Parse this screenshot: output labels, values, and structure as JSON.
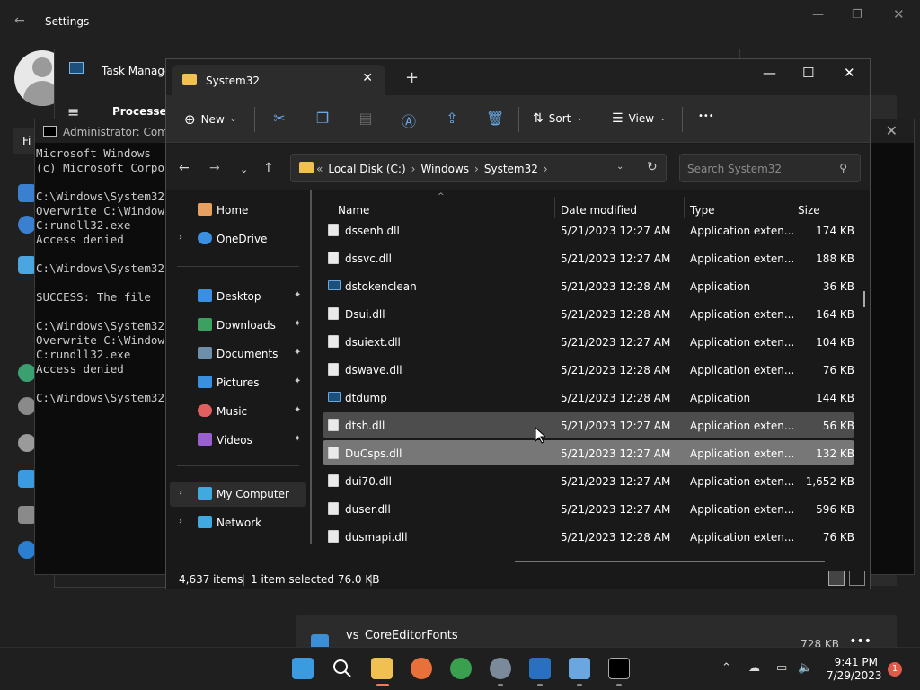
{
  "settings": {
    "title": "Settings",
    "vs_item": {
      "name": "vs_CoreEditorFonts",
      "size": "728 KB"
    }
  },
  "task_manager": {
    "title": "Task Manager",
    "section": "Processes"
  },
  "cmd": {
    "title": "Administrator: Comm",
    "lines": [
      "Microsoft Windows",
      "(c) Microsoft Corpo",
      "",
      "C:\\Windows\\System32",
      "Overwrite C:\\Window",
      "C:rundll32.exe",
      "Access denied",
      "",
      "C:\\Windows\\System32",
      "",
      "SUCCESS: The file",
      "",
      "C:\\Windows\\System32",
      "Overwrite C:\\Window",
      "C:rundll32.exe",
      "Access denied",
      "",
      "C:\\Windows\\System32"
    ],
    "fi_label": "Fi"
  },
  "explorer": {
    "tab_title": "System32",
    "toolbar": {
      "new": "New",
      "sort": "Sort",
      "view": "View",
      "more": "•••"
    },
    "address": {
      "crumbs": [
        "Local Disk (C:)",
        "Windows",
        "System32"
      ]
    },
    "search_placeholder": "Search System32",
    "nav": {
      "home": "Home",
      "onedrive": "OneDrive",
      "desktop": "Desktop",
      "downloads": "Downloads",
      "documents": "Documents",
      "pictures": "Pictures",
      "music": "Music",
      "videos": "Videos",
      "my_computer": "My Computer",
      "network": "Network"
    },
    "columns": {
      "name": "Name",
      "date": "Date modified",
      "type": "Type",
      "size": "Size"
    },
    "files": [
      {
        "name": "dssenh.dll",
        "date": "5/21/2023 12:27 AM",
        "type": "Application exten...",
        "size": "174 KB",
        "icon": "dll"
      },
      {
        "name": "dssvc.dll",
        "date": "5/21/2023 12:27 AM",
        "type": "Application exten...",
        "size": "188 KB",
        "icon": "dll"
      },
      {
        "name": "dstokenclean",
        "date": "5/21/2023 12:28 AM",
        "type": "Application",
        "size": "36 KB",
        "icon": "app"
      },
      {
        "name": "Dsui.dll",
        "date": "5/21/2023 12:28 AM",
        "type": "Application exten...",
        "size": "164 KB",
        "icon": "dll"
      },
      {
        "name": "dsuiext.dll",
        "date": "5/21/2023 12:27 AM",
        "type": "Application exten...",
        "size": "104 KB",
        "icon": "dll"
      },
      {
        "name": "dswave.dll",
        "date": "5/21/2023 12:28 AM",
        "type": "Application exten...",
        "size": "76 KB",
        "icon": "dll"
      },
      {
        "name": "dtdump",
        "date": "5/21/2023 12:28 AM",
        "type": "Application",
        "size": "144 KB",
        "icon": "app"
      },
      {
        "name": "dtsh.dll",
        "date": "5/21/2023 12:27 AM",
        "type": "Application exten...",
        "size": "56 KB",
        "icon": "dll",
        "state": "hover"
      },
      {
        "name": "DuCsps.dll",
        "date": "5/21/2023 12:27 AM",
        "type": "Application exten...",
        "size": "132 KB",
        "icon": "dll",
        "state": "selected"
      },
      {
        "name": "dui70.dll",
        "date": "5/21/2023 12:27 AM",
        "type": "Application exten...",
        "size": "1,652 KB",
        "icon": "dll"
      },
      {
        "name": "duser.dll",
        "date": "5/21/2023 12:27 AM",
        "type": "Application exten...",
        "size": "596 KB",
        "icon": "dll"
      },
      {
        "name": "dusmapi.dll",
        "date": "5/21/2023 12:28 AM",
        "type": "Application exten...",
        "size": "76 KB",
        "icon": "dll"
      }
    ],
    "status": {
      "items": "4,637 items",
      "selected": "1 item selected  76.0 KB"
    }
  },
  "taskbar": {
    "time": "9:41 PM",
    "date": "7/29/2023",
    "notifications": "1"
  },
  "colors": {
    "accent": "#69a9e8",
    "folder": "#f0c050",
    "selected_row": "#777777",
    "hover_row": "#4d4d4d"
  }
}
